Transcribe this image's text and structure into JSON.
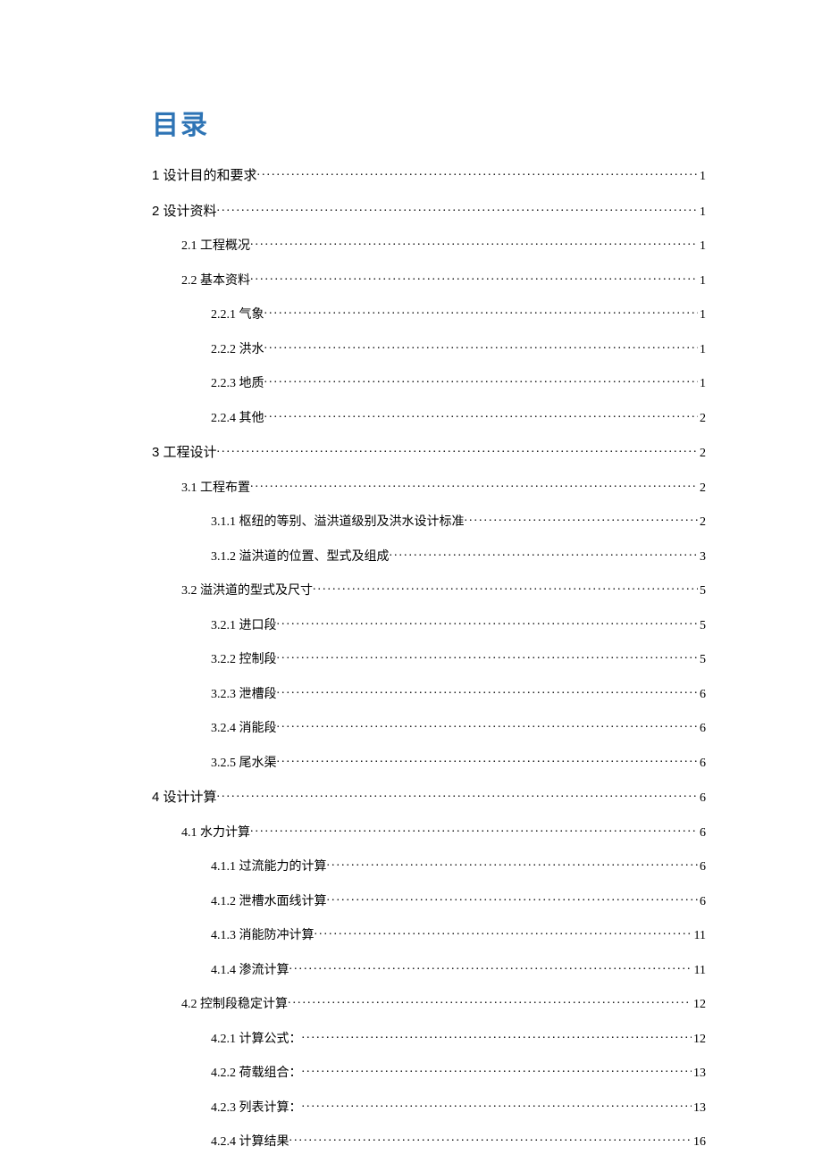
{
  "toc": {
    "title": "目录",
    "entries": [
      {
        "level": 1,
        "label": "1 设计目的和要求 ",
        "page": "1"
      },
      {
        "level": 1,
        "label": "2 设计资料",
        "page": "1"
      },
      {
        "level": 2,
        "label": "2.1 工程概况",
        "page": "1"
      },
      {
        "level": 2,
        "label": "2.2 基本资料",
        "page": "1"
      },
      {
        "level": 3,
        "label": "2.2.1 气象",
        "page": "1"
      },
      {
        "level": 3,
        "label": "2.2.2 洪水",
        "page": "1"
      },
      {
        "level": 3,
        "label": "2.2.3 地质",
        "page": "1"
      },
      {
        "level": 3,
        "label": "2.2.4 其他",
        "page": "2"
      },
      {
        "level": 1,
        "label": "3 工程设计 ",
        "page": "2"
      },
      {
        "level": 2,
        "label": "3.1 工程布置",
        "page": "2"
      },
      {
        "level": 3,
        "label": "3.1.1 枢纽的等别、溢洪道级别及洪水设计标准 ",
        "page": "2"
      },
      {
        "level": 3,
        "label": "3.1.2 溢洪道的位置、型式及组成 ",
        "page": "3"
      },
      {
        "level": 2,
        "label": "3.2 溢洪道的型式及尺寸",
        "page": "5"
      },
      {
        "level": 3,
        "label": "3.2.1 进口段 ",
        "page": "5"
      },
      {
        "level": 3,
        "label": "3.2.2 控制段 ",
        "page": "5"
      },
      {
        "level": 3,
        "label": "3.2.3 泄槽段",
        "page": "6"
      },
      {
        "level": 3,
        "label": "3.2.4 消能段 ",
        "page": "6"
      },
      {
        "level": 3,
        "label": "3.2.5 尾水渠",
        "page": "6"
      },
      {
        "level": 1,
        "label": "4 设计计算 ",
        "page": "6"
      },
      {
        "level": 2,
        "label": "4.1 水力计算 ",
        "page": "6"
      },
      {
        "level": 3,
        "label": "4.1.1 过流能力的计算 ",
        "page": "6"
      },
      {
        "level": 3,
        "label": "4.1.2 泄槽水面线计算 ",
        "page": "6"
      },
      {
        "level": 3,
        "label": "4.1.3 消能防冲计算 ",
        "page": "11"
      },
      {
        "level": 3,
        "label": "4.1.4 渗流计算 ",
        "page": "11"
      },
      {
        "level": 2,
        "label": "4.2 控制段稳定计算",
        "page": "12"
      },
      {
        "level": 3,
        "label": "4.2.1 计算公式： ",
        "page": "12"
      },
      {
        "level": 3,
        "label": "4.2.2 荷载组合： ",
        "page": "13"
      },
      {
        "level": 3,
        "label": "4.2.3 列表计算： ",
        "page": "13"
      },
      {
        "level": 3,
        "label": "4.2.4 计算结果 ",
        "page": "16"
      }
    ]
  }
}
